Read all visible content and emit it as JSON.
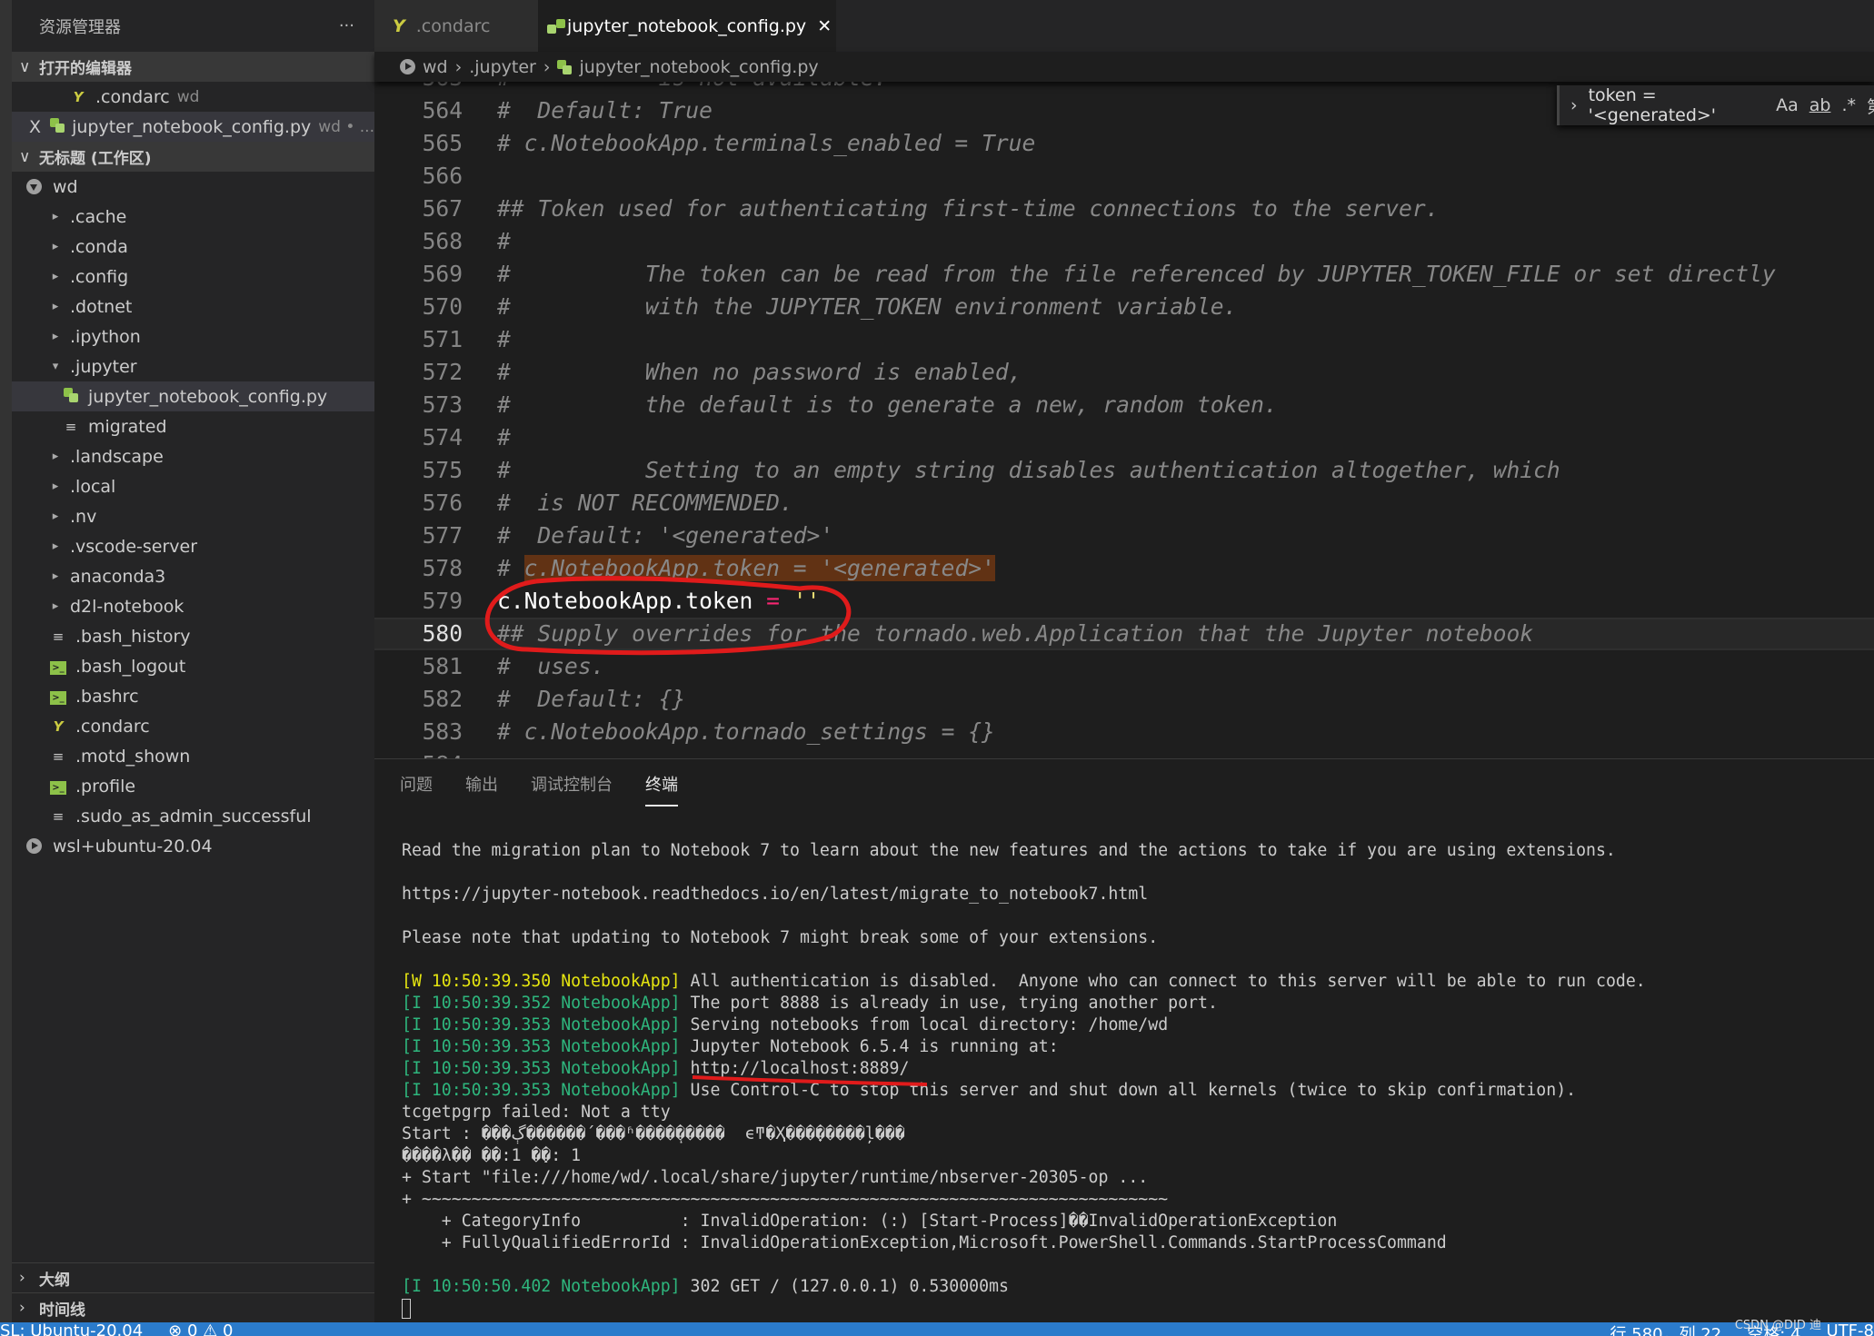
{
  "sidebar": {
    "title": "资源管理器",
    "more": "···",
    "open_editors_label": "打开的编辑器",
    "open_editors": [
      {
        "name": ".condarc",
        "dir": "wd",
        "icon": "yaml-icon"
      },
      {
        "name": "jupyter_notebook_config.py",
        "dir": "wd • ...",
        "icon": "python-icon",
        "selected": true,
        "close": "X"
      }
    ],
    "workspace_label": "无标题 (工作区)",
    "tree": [
      {
        "name": "wd",
        "depth": 0,
        "type": "root-open"
      },
      {
        "name": ".cache",
        "depth": 1,
        "type": "folder"
      },
      {
        "name": ".conda",
        "depth": 1,
        "type": "folder"
      },
      {
        "name": ".config",
        "depth": 1,
        "type": "folder"
      },
      {
        "name": ".dotnet",
        "depth": 1,
        "type": "folder"
      },
      {
        "name": ".ipython",
        "depth": 1,
        "type": "folder"
      },
      {
        "name": ".jupyter",
        "depth": 1,
        "type": "folder-open"
      },
      {
        "name": "jupyter_notebook_config.py",
        "depth": 2,
        "type": "python",
        "selected": true
      },
      {
        "name": "migrated",
        "depth": 2,
        "type": "text"
      },
      {
        "name": ".landscape",
        "depth": 1,
        "type": "folder"
      },
      {
        "name": ".local",
        "depth": 1,
        "type": "folder"
      },
      {
        "name": ".nv",
        "depth": 1,
        "type": "folder"
      },
      {
        "name": ".vscode-server",
        "depth": 1,
        "type": "folder"
      },
      {
        "name": "anaconda3",
        "depth": 1,
        "type": "folder"
      },
      {
        "name": "d2l-notebook",
        "depth": 1,
        "type": "folder"
      },
      {
        "name": ".bash_history",
        "depth": 1,
        "type": "text"
      },
      {
        "name": ".bash_logout",
        "depth": 1,
        "type": "terminal"
      },
      {
        "name": ".bashrc",
        "depth": 1,
        "type": "terminal"
      },
      {
        "name": ".condarc",
        "depth": 1,
        "type": "yaml"
      },
      {
        "name": ".motd_shown",
        "depth": 1,
        "type": "text"
      },
      {
        "name": ".profile",
        "depth": 1,
        "type": "terminal"
      },
      {
        "name": ".sudo_as_admin_successful",
        "depth": 1,
        "type": "text"
      },
      {
        "name": "wsl+ubuntu-20.04",
        "depth": 0,
        "type": "root"
      }
    ],
    "outline_label": "大纲",
    "timeline_label": "时间线"
  },
  "tabs": [
    {
      "label": ".condarc",
      "icon": "yaml-icon",
      "active": false
    },
    {
      "label": "jupyter_notebook_config.py",
      "icon": "python-icon",
      "active": true,
      "close": "✕"
    }
  ],
  "breadcrumb": [
    "wd",
    "jupyter",
    "jupyter_notebook_config.py"
  ],
  "breadcrumb_display": [
    ".jupyter"
  ],
  "find": {
    "query": "token = '<generated>'",
    "match_case": "Aa",
    "whole_word": "ab",
    "regex": ".*",
    "count": "第"
  },
  "editor": {
    "current_line": 580,
    "lines": [
      {
        "n": 563,
        "t": [
          [
            "cm",
            "#           is not available."
          ]
        ]
      },
      {
        "n": 564,
        "t": [
          [
            "cm",
            "#  Default: True"
          ]
        ]
      },
      {
        "n": 565,
        "t": [
          [
            "cm",
            "# c.NotebookApp.terminals_enabled = True"
          ]
        ]
      },
      {
        "n": 566,
        "t": []
      },
      {
        "n": 567,
        "t": [
          [
            "cm",
            "## Token used for authenticating first-time connections to the server."
          ]
        ]
      },
      {
        "n": 568,
        "t": [
          [
            "cm",
            "#"
          ]
        ]
      },
      {
        "n": 569,
        "t": [
          [
            "cm",
            "#          The token can be read from the file referenced by JUPYTER_TOKEN_FILE or set directly"
          ]
        ]
      },
      {
        "n": 570,
        "t": [
          [
            "cm",
            "#          with the JUPYTER_TOKEN environment variable."
          ]
        ]
      },
      {
        "n": 571,
        "t": [
          [
            "cm",
            "#"
          ]
        ]
      },
      {
        "n": 572,
        "t": [
          [
            "cm",
            "#          When no password is enabled,"
          ]
        ]
      },
      {
        "n": 573,
        "t": [
          [
            "cm",
            "#          the default is to generate a new, random token."
          ]
        ]
      },
      {
        "n": 574,
        "t": [
          [
            "cm",
            "#"
          ]
        ]
      },
      {
        "n": 575,
        "t": [
          [
            "cm",
            "#          Setting to an empty string disables authentication altogether, which"
          ]
        ]
      },
      {
        "n": 576,
        "t": [
          [
            "cm",
            "#  is NOT RECOMMENDED."
          ]
        ]
      },
      {
        "n": 577,
        "t": [
          [
            "cm",
            "#  Default: '<generated>'"
          ]
        ]
      },
      {
        "n": 578,
        "t": [
          [
            "cm",
            "# "
          ],
          [
            "cm hl",
            "c.NotebookApp.token = '<generated>'"
          ]
        ]
      },
      {
        "n": 579,
        "t": [
          [
            "#ffffff",
            "c.NotebookApp.token "
          ],
          [
            "#f92672",
            "="
          ],
          [
            "#e6db74",
            " ''"
          ]
        ]
      },
      {
        "n": 580,
        "t": [
          [
            "cm",
            "## Supply overrides for the tornado.web.Application that the Jupyter notebook"
          ]
        ]
      },
      {
        "n": 581,
        "t": [
          [
            "cm",
            "#  uses."
          ]
        ]
      },
      {
        "n": 582,
        "t": [
          [
            "cm",
            "#  Default: {}"
          ]
        ]
      },
      {
        "n": 583,
        "t": [
          [
            "cm",
            "# c.NotebookApp.tornado_settings = {}"
          ]
        ]
      },
      {
        "n": 584,
        "t": []
      }
    ]
  },
  "panel": {
    "tabs": [
      "问题",
      "输出",
      "调试控制台",
      "终端"
    ],
    "active_tab": "终端"
  },
  "terminal": {
    "colors": {
      "warn": "#e5e510",
      "info": "#2eb67d"
    },
    "lines": [
      {
        "x": "Read the migration plan to Notebook 7 to learn about the new features and the actions to take if you are using extensions."
      },
      {
        "x": ""
      },
      {
        "x": "https://jupyter-notebook.readthedocs.io/en/latest/migrate_to_notebook7.html"
      },
      {
        "x": ""
      },
      {
        "x": "Please note that updating to Notebook 7 might break some of your extensions."
      },
      {
        "x": ""
      },
      {
        "p": "[W 10:50:39.350 NotebookApp]",
        "k": "warn",
        "x": " All authentication is disabled.  Anyone who can connect to this server will be able to run code."
      },
      {
        "p": "[I 10:50:39.352 NotebookApp]",
        "k": "info",
        "x": " The port 8888 is already in use, trying another port."
      },
      {
        "p": "[I 10:50:39.353 NotebookApp]",
        "k": "info",
        "x": " Serving notebooks from local directory: /home/wd"
      },
      {
        "p": "[I 10:50:39.353 NotebookApp]",
        "k": "info",
        "x": " Jupyter Notebook 6.5.4 is running at:"
      },
      {
        "p": "[I 10:50:39.353 NotebookApp]",
        "k": "info",
        "x": " http://localhost:8889/"
      },
      {
        "p": "[I 10:50:39.353 NotebookApp]",
        "k": "info",
        "x": " Use Control-C to stop this server and shut down all kernels (twice to skip confirmation)."
      },
      {
        "x": "tcgetpgrp failed: Not a tty"
      },
      {
        "x": "Start : ���ڳ������´���ʱ����ܴ�����  ϵͳ�Ҳ���ָ�����ļ���"
      },
      {
        "x": "����λ�� ��:1 �ַ�: 1"
      },
      {
        "x": "+ Start \"file:///home/wd/.local/share/jupyter/runtime/nbserver-20305-op ..."
      },
      {
        "x": "+ ~~~~~~~~~~~~~~~~~~~~~~~~~~~~~~~~~~~~~~~~~~~~~~~~~~~~~~~~~~~~~~~~~~~~~~~~~~~"
      },
      {
        "x": "    + CategoryInfo          : InvalidOperation: (:) [Start-Process]��InvalidOperationException"
      },
      {
        "x": "    + FullyQualifiedErrorId : InvalidOperationException,Microsoft.PowerShell.Commands.StartProcessCommand"
      },
      {
        "x": ""
      },
      {
        "p": "[I 10:50:50.402 NotebookApp]",
        "k": "info",
        "x": " 302 GET / (127.0.0.1) 0.530000ms"
      }
    ]
  },
  "status": {
    "remote": "SL: Ubuntu-20.04",
    "errors": "0",
    "warnings": "0",
    "position": "行 580，列 22",
    "indent": "空格: 4",
    "encoding": "UTF-8",
    "color": "#2b7bcb"
  },
  "watermark": "CSDN @DID 迪",
  "annotation_color": "#e01b1b"
}
